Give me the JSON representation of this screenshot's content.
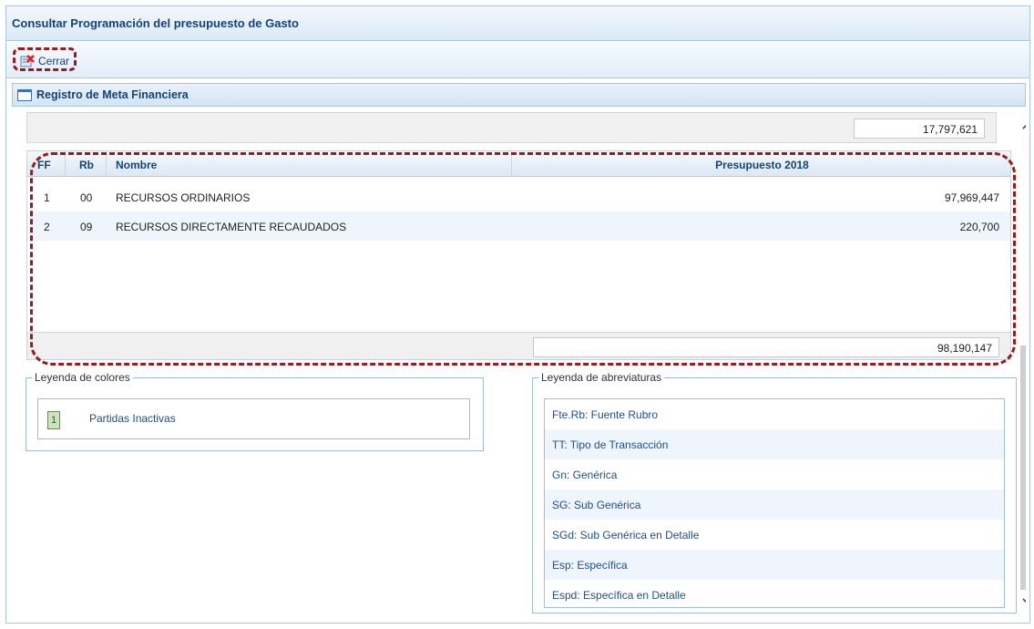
{
  "window": {
    "title": "Consultar Programación del presupuesto de Gasto"
  },
  "toolbar": {
    "close_label": "Cerrar"
  },
  "section": {
    "title": "Registro de Meta Financiera"
  },
  "top_total": "17,797,621",
  "grid": {
    "columns": {
      "ff": "FF",
      "rb": "Rb",
      "nombre": "Nombre",
      "presupuesto": "Presupuesto 2018"
    },
    "rows": [
      {
        "ff": "1",
        "rb": "00",
        "nombre": "RECURSOS ORDINARIOS",
        "presupuesto": "97,969,447"
      },
      {
        "ff": "2",
        "rb": "09",
        "nombre": "RECURSOS DIRECTAMENTE RECAUDADOS",
        "presupuesto": "220,700"
      }
    ],
    "total": "98,190,147"
  },
  "legend_colors": {
    "title": "Leyenda de colores",
    "swatch_text": "1",
    "label": "Partidas Inactivas",
    "swatch_color": "#cbe5b8"
  },
  "legend_abbr": {
    "title": "Leyenda de abreviaturas",
    "items": [
      "Fte.Rb: Fuente Rubro",
      "TT: Tipo de Transacción",
      "Gn: Genérica",
      "SG: Sub Genérica",
      "SGd: Sub Genérica en Detalle",
      "Esp: Específica",
      "Espd: Específica en Detalle"
    ]
  },
  "icons": {
    "close": "close-doc-icon",
    "window": "window-icon",
    "scroll_up": "chevron-up-icon",
    "scroll_down": "chevron-down-icon"
  },
  "colors": {
    "accent": "#14437a",
    "highlight": "#9b1b1b"
  }
}
